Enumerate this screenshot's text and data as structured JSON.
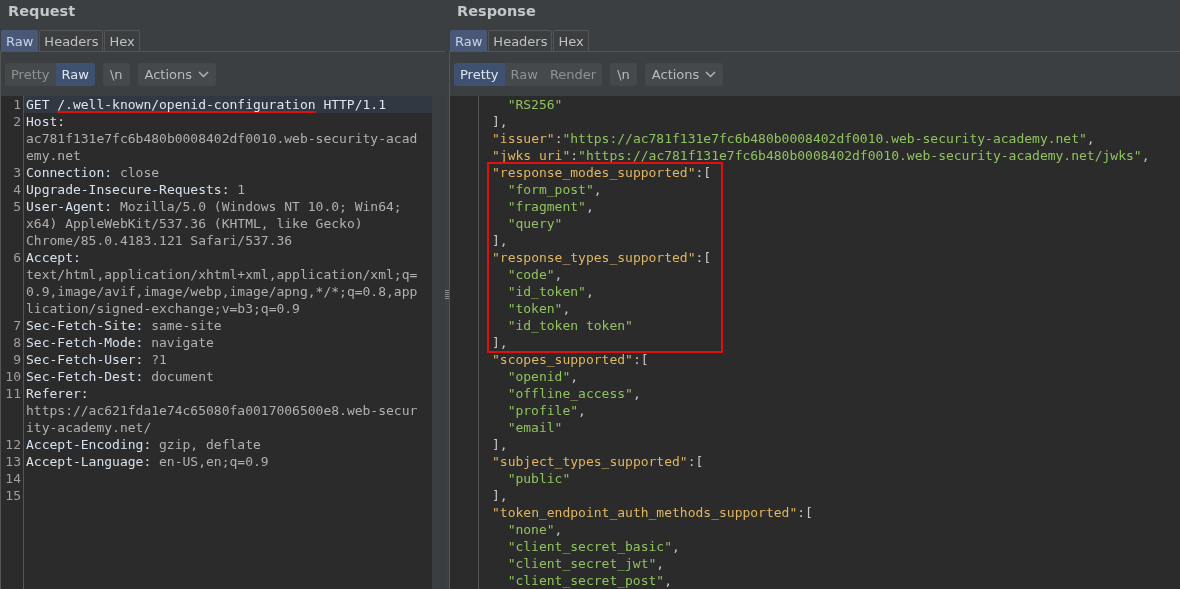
{
  "request": {
    "title": "Request",
    "tabs": [
      {
        "label": "Raw",
        "selected": true
      },
      {
        "label": "Headers",
        "selected": false
      },
      {
        "label": "Hex",
        "selected": false
      }
    ],
    "view_modes": [
      {
        "label": "Pretty",
        "selected": false
      },
      {
        "label": "Raw",
        "selected": true
      }
    ],
    "newline_button": "\\n",
    "actions_button": "Actions",
    "lines": [
      {
        "number": "1",
        "selected": true,
        "rows": [
          [
            {
              "kind": "method",
              "text": "GET"
            },
            {
              "kind": "path",
              "text": "/.well-known/openid-configuration",
              "underlined": true
            },
            {
              "kind": "method",
              "text": "HTTP/1.1"
            }
          ]
        ]
      },
      {
        "number": "2",
        "selected": false,
        "rows": [
          [
            {
              "kind": "name",
              "text": "Host:"
            }
          ],
          [
            {
              "kind": "value",
              "text": "ac781f131e7fc6b480b0008402df0010.web-security-acad"
            }
          ],
          [
            {
              "kind": "value",
              "text": "emy.net"
            }
          ]
        ]
      },
      {
        "number": "3",
        "selected": false,
        "rows": [
          [
            {
              "kind": "name",
              "text": "Connection:"
            },
            {
              "kind": "value",
              "text": "close"
            }
          ]
        ]
      },
      {
        "number": "4",
        "selected": false,
        "rows": [
          [
            {
              "kind": "name",
              "text": "Upgrade-Insecure-Requests:"
            },
            {
              "kind": "value",
              "text": "1"
            }
          ]
        ]
      },
      {
        "number": "5",
        "selected": false,
        "rows": [
          [
            {
              "kind": "name",
              "text": "User-Agent:"
            },
            {
              "kind": "value",
              "text": "Mozilla/5.0 (Windows NT 10.0; Win64;"
            }
          ],
          [
            {
              "kind": "value",
              "text": "x64) AppleWebKit/537.36 (KHTML, like Gecko)"
            }
          ],
          [
            {
              "kind": "value",
              "text": "Chrome/85.0.4183.121 Safari/537.36"
            }
          ]
        ]
      },
      {
        "number": "6",
        "selected": false,
        "rows": [
          [
            {
              "kind": "name",
              "text": "Accept:"
            }
          ],
          [
            {
              "kind": "value",
              "text": "text/html,application/xhtml+xml,application/xml;q="
            }
          ],
          [
            {
              "kind": "value",
              "text": "0.9,image/avif,image/webp,image/apng,*/*;q=0.8,app"
            }
          ],
          [
            {
              "kind": "value",
              "text": "lication/signed-exchange;v=b3;q=0.9"
            }
          ]
        ]
      },
      {
        "number": "7",
        "selected": false,
        "rows": [
          [
            {
              "kind": "name",
              "text": "Sec-Fetch-Site:"
            },
            {
              "kind": "value",
              "text": "same-site"
            }
          ]
        ]
      },
      {
        "number": "8",
        "selected": false,
        "rows": [
          [
            {
              "kind": "name",
              "text": "Sec-Fetch-Mode:"
            },
            {
              "kind": "value",
              "text": "navigate"
            }
          ]
        ]
      },
      {
        "number": "9",
        "selected": false,
        "rows": [
          [
            {
              "kind": "name",
              "text": "Sec-Fetch-User:"
            },
            {
              "kind": "value",
              "text": "?1"
            }
          ]
        ]
      },
      {
        "number": "10",
        "selected": false,
        "rows": [
          [
            {
              "kind": "name",
              "text": "Sec-Fetch-Dest:"
            },
            {
              "kind": "value",
              "text": "document"
            }
          ]
        ]
      },
      {
        "number": "11",
        "selected": false,
        "rows": [
          [
            {
              "kind": "name",
              "text": "Referer:"
            }
          ],
          [
            {
              "kind": "value",
              "text": "https://ac621fda1e74c65080fa0017006500e8.web-secur"
            }
          ],
          [
            {
              "kind": "value",
              "text": "ity-academy.net/"
            }
          ]
        ]
      },
      {
        "number": "12",
        "selected": false,
        "rows": [
          [
            {
              "kind": "name",
              "text": "Accept-Encoding:"
            },
            {
              "kind": "value",
              "text": "gzip, deflate"
            }
          ]
        ]
      },
      {
        "number": "13",
        "selected": false,
        "rows": [
          [
            {
              "kind": "name",
              "text": "Accept-Language:"
            },
            {
              "kind": "value",
              "text": "en-US,en;q=0.9"
            }
          ]
        ]
      },
      {
        "number": "14",
        "selected": false,
        "rows": [
          []
        ]
      },
      {
        "number": "15",
        "selected": false,
        "rows": [
          []
        ]
      }
    ]
  },
  "response": {
    "title": "Response",
    "tabs": [
      {
        "label": "Raw",
        "selected": true
      },
      {
        "label": "Headers",
        "selected": false
      },
      {
        "label": "Hex",
        "selected": false
      }
    ],
    "view_modes": [
      {
        "label": "Pretty",
        "selected": true
      },
      {
        "label": "Raw",
        "selected": false
      },
      {
        "label": "Render",
        "selected": false
      }
    ],
    "newline_button": "\\n",
    "actions_button": "Actions",
    "body": [
      {
        "kind": "array",
        "children": [
          {
            "value": "\"RS256\""
          }
        ],
        "close": "],"
      },
      {
        "kind": "field",
        "key": "\"issuer\"",
        "colon": ":",
        "value": "\"https://ac781f131e7fc6b480b0008402df0010.web-security-academy.net\"",
        "comma": ","
      },
      {
        "kind": "field",
        "key": "\"jwks_uri\"",
        "colon": ":",
        "value": "\"https://ac781f131e7fc6b480b0008402df0010.web-security-academy.net/jwks\"",
        "comma": ","
      },
      {
        "kind": "annotation-box",
        "children": [
          {
            "kind": "array",
            "key": "\"response_modes_supported\"",
            "colon": ":",
            "open": "[",
            "children": [
              {
                "value": "\"form_post\"",
                "comma": ","
              },
              {
                "value": "\"fragment\"",
                "comma": ","
              },
              {
                "value": "\"query\""
              }
            ],
            "close": "],"
          },
          {
            "kind": "array",
            "key": "\"response_types_supported\"",
            "colon": ":",
            "open": "[",
            "children": [
              {
                "value": "\"code\"",
                "comma": ","
              },
              {
                "value": "\"id_token\"",
                "comma": ","
              },
              {
                "value": "\"token\"",
                "comma": ","
              },
              {
                "value": "\"id_token token\""
              }
            ],
            "close": "],"
          }
        ]
      },
      {
        "kind": "array",
        "key": "\"scopes_supported\"",
        "colon": ":",
        "open": "[",
        "children": [
          {
            "value": "\"openid\"",
            "comma": ","
          },
          {
            "value": "\"offline_access\"",
            "comma": ","
          },
          {
            "value": "\"profile\"",
            "comma": ","
          },
          {
            "value": "\"email\""
          }
        ],
        "close": "],"
      },
      {
        "kind": "array",
        "key": "\"subject_types_supported\"",
        "colon": ":",
        "open": "[",
        "children": [
          {
            "value": "\"public\""
          }
        ],
        "close": "],"
      },
      {
        "kind": "array",
        "key": "\"token_endpoint_auth_methods_supported\"",
        "colon": ":",
        "open": "[",
        "children": [
          {
            "value": "\"none\"",
            "comma": ","
          },
          {
            "value": "\"client_secret_basic\"",
            "comma": ","
          },
          {
            "value": "\"client_secret_jwt\"",
            "comma": ","
          },
          {
            "value": "\"client_secret_post\"",
            "comma": ","
          }
        ]
      }
    ]
  }
}
